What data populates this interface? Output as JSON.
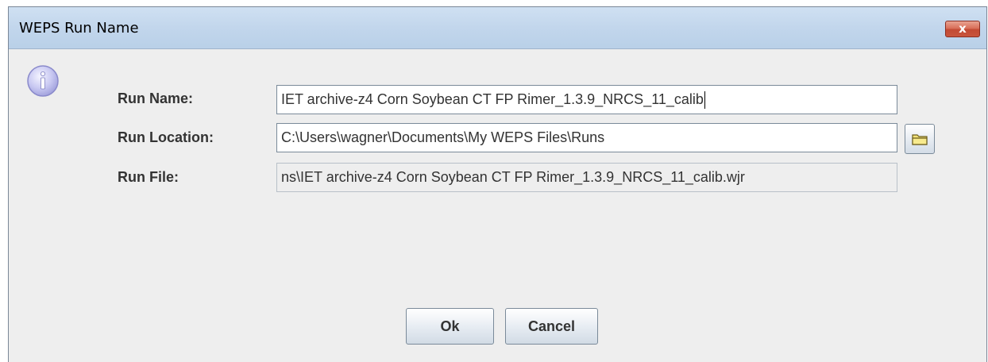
{
  "window": {
    "title": "WEPS Run Name",
    "close_glyph": "x"
  },
  "icons": {
    "info": "info-icon",
    "folder": "folder-icon",
    "close": "close-icon"
  },
  "form": {
    "run_name": {
      "label": "Run Name:",
      "value": "IET archive-z4 Corn Soybean CT FP Rimer_1.3.9_NRCS_11_calib"
    },
    "run_location": {
      "label": "Run Location:",
      "value": "C:\\Users\\wagner\\Documents\\My WEPS Files\\Runs"
    },
    "run_file": {
      "label": "Run File:",
      "value": "ns\\IET archive-z4 Corn Soybean CT FP Rimer_1.3.9_NRCS_11_calib.wjr"
    }
  },
  "buttons": {
    "ok": "Ok",
    "cancel": "Cancel"
  },
  "colors": {
    "titlebar": "#c2d6ec",
    "dialog_background": "#eeeeee",
    "close_button": "#c24a33",
    "info_icon": "#b8b8ee"
  }
}
